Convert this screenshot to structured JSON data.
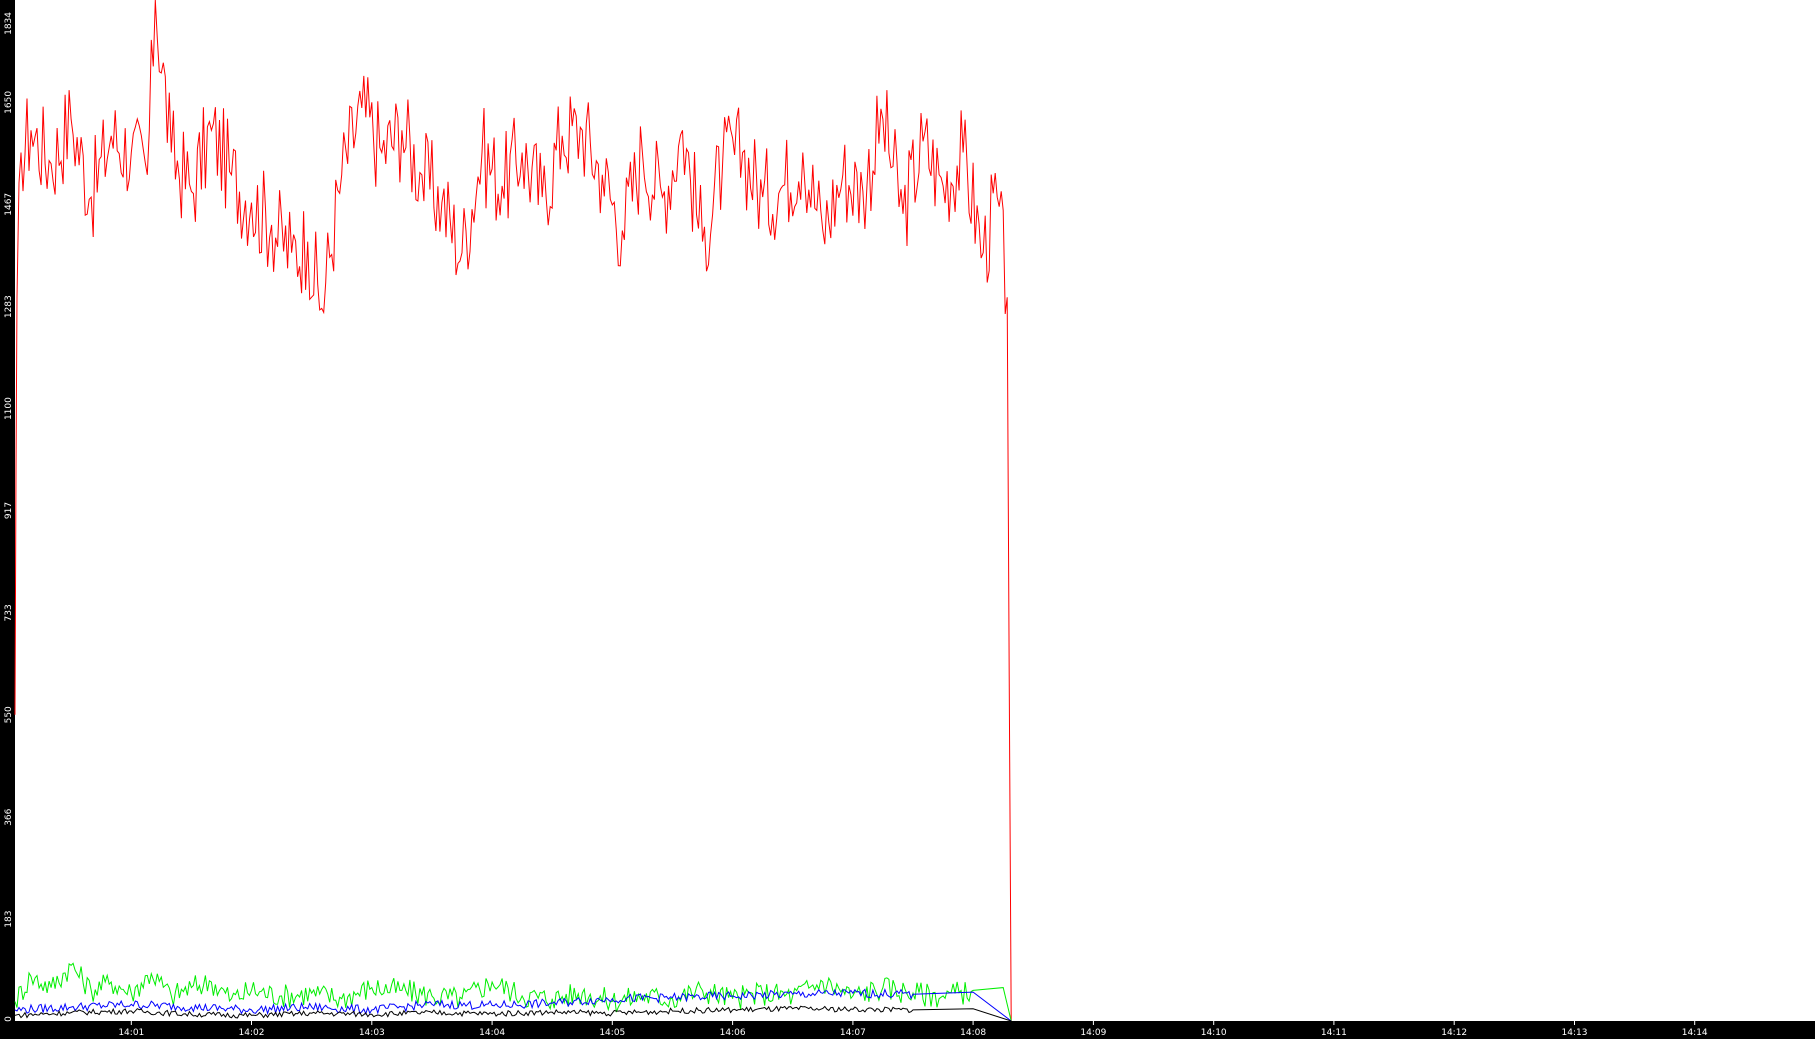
{
  "chart_data": {
    "type": "line",
    "title": "",
    "xlabel": "",
    "ylabel": "",
    "y_ticks": [
      "0",
      "183",
      "366",
      "550",
      "733",
      "917",
      "1100",
      "1283",
      "1467",
      "1650",
      "1834"
    ],
    "y_tick_values": [
      0,
      183,
      366,
      550,
      733,
      917,
      1100,
      1283,
      1467,
      1650,
      1834
    ],
    "ylim": [
      0,
      1834
    ],
    "x_ticks": [
      "14:01",
      "14:02",
      "14:03",
      "14:04",
      "14:05",
      "14:06",
      "14:07",
      "14:08",
      "14:09",
      "14:10",
      "14:11",
      "14:12",
      "14:13",
      "14:14"
    ],
    "xlim": [
      "14:00:02",
      "14:15:00"
    ],
    "grid": false,
    "legend": "none",
    "colors": {
      "axis_bg": "#000000",
      "tick_text": "#ffffff",
      "series_1": "#ff0000",
      "series_2": "#00ee00",
      "series_3": "#0000ff",
      "series_4": "#000000"
    },
    "series": [
      {
        "color": "#ff0000",
        "x": [
          "14:00:02",
          "14:00:03",
          "14:00:05",
          "14:00:10",
          "14:00:20",
          "14:00:30",
          "14:00:40",
          "14:00:50",
          "14:01:00",
          "14:01:08",
          "14:01:12",
          "14:01:20",
          "14:01:30",
          "14:01:40",
          "14:01:50",
          "14:02:00",
          "14:02:10",
          "14:02:20",
          "14:02:28",
          "14:02:35",
          "14:02:45",
          "14:02:55",
          "14:03:05",
          "14:03:15",
          "14:03:25",
          "14:03:35",
          "14:03:45",
          "14:03:55",
          "14:04:05",
          "14:04:15",
          "14:04:25",
          "14:04:35",
          "14:04:45",
          "14:04:55",
          "14:05:05",
          "14:05:15",
          "14:05:25",
          "14:05:35",
          "14:05:45",
          "14:05:55",
          "14:06:05",
          "14:06:15",
          "14:06:25",
          "14:06:35",
          "14:06:45",
          "14:06:55",
          "14:07:05",
          "14:07:15",
          "14:07:25",
          "14:07:35",
          "14:07:45",
          "14:07:55",
          "14:08:05",
          "14:08:12",
          "14:08:17",
          "14:08:18",
          "14:08:19"
        ],
        "y": [
          550,
          1300,
          1560,
          1600,
          1540,
          1620,
          1480,
          1590,
          1560,
          1520,
          1834,
          1560,
          1490,
          1600,
          1520,
          1470,
          1430,
          1380,
          1400,
          1280,
          1520,
          1640,
          1560,
          1600,
          1520,
          1470,
          1380,
          1560,
          1500,
          1560,
          1480,
          1590,
          1600,
          1520,
          1420,
          1560,
          1480,
          1600,
          1400,
          1540,
          1560,
          1480,
          1500,
          1560,
          1420,
          1520,
          1490,
          1620,
          1450,
          1580,
          1500,
          1560,
          1380,
          1480,
          1300,
          620,
          0
        ]
      },
      {
        "color": "#00ee00",
        "x": [
          "14:00:02",
          "14:00:10",
          "14:00:20",
          "14:00:30",
          "14:00:40",
          "14:00:50",
          "14:01:00",
          "14:01:10",
          "14:01:20",
          "14:01:30",
          "14:01:40",
          "14:01:50",
          "14:02:00",
          "14:02:15",
          "14:02:30",
          "14:02:45",
          "14:03:00",
          "14:03:15",
          "14:03:30",
          "14:03:45",
          "14:04:00",
          "14:04:15",
          "14:04:30",
          "14:04:45",
          "14:05:00",
          "14:05:15",
          "14:05:30",
          "14:05:45",
          "14:06:00",
          "14:06:15",
          "14:06:30",
          "14:06:45",
          "14:07:00",
          "14:07:15",
          "14:07:30",
          "14:07:45",
          "14:08:00",
          "14:08:15",
          "14:08:19"
        ],
        "y": [
          35,
          80,
          60,
          100,
          55,
          70,
          50,
          85,
          45,
          60,
          70,
          40,
          55,
          45,
          50,
          40,
          60,
          55,
          45,
          40,
          70,
          45,
          40,
          50,
          35,
          45,
          40,
          55,
          40,
          50,
          45,
          70,
          45,
          60,
          50,
          45,
          55,
          60,
          0
        ]
      },
      {
        "color": "#0000ff",
        "x": [
          "14:00:02",
          "14:00:30",
          "14:01:00",
          "14:01:30",
          "14:02:00",
          "14:02:30",
          "14:03:00",
          "14:03:30",
          "14:04:00",
          "14:04:30",
          "14:05:00",
          "14:05:30",
          "14:06:00",
          "14:06:30",
          "14:07:00",
          "14:07:30",
          "14:08:00",
          "14:08:19"
        ],
        "y": [
          20,
          25,
          30,
          25,
          20,
          25,
          20,
          30,
          28,
          32,
          40,
          42,
          45,
          48,
          50,
          48,
          52,
          0
        ]
      },
      {
        "color": "#000000",
        "x": [
          "14:00:02",
          "14:00:30",
          "14:01:00",
          "14:01:30",
          "14:02:00",
          "14:02:30",
          "14:03:00",
          "14:03:30",
          "14:04:00",
          "14:04:30",
          "14:05:00",
          "14:05:30",
          "14:06:00",
          "14:06:30",
          "14:07:00",
          "14:07:30",
          "14:08:00",
          "14:08:19"
        ],
        "y": [
          10,
          15,
          18,
          12,
          10,
          14,
          12,
          15,
          13,
          16,
          14,
          18,
          20,
          22,
          21,
          20,
          22,
          0
        ]
      }
    ]
  }
}
